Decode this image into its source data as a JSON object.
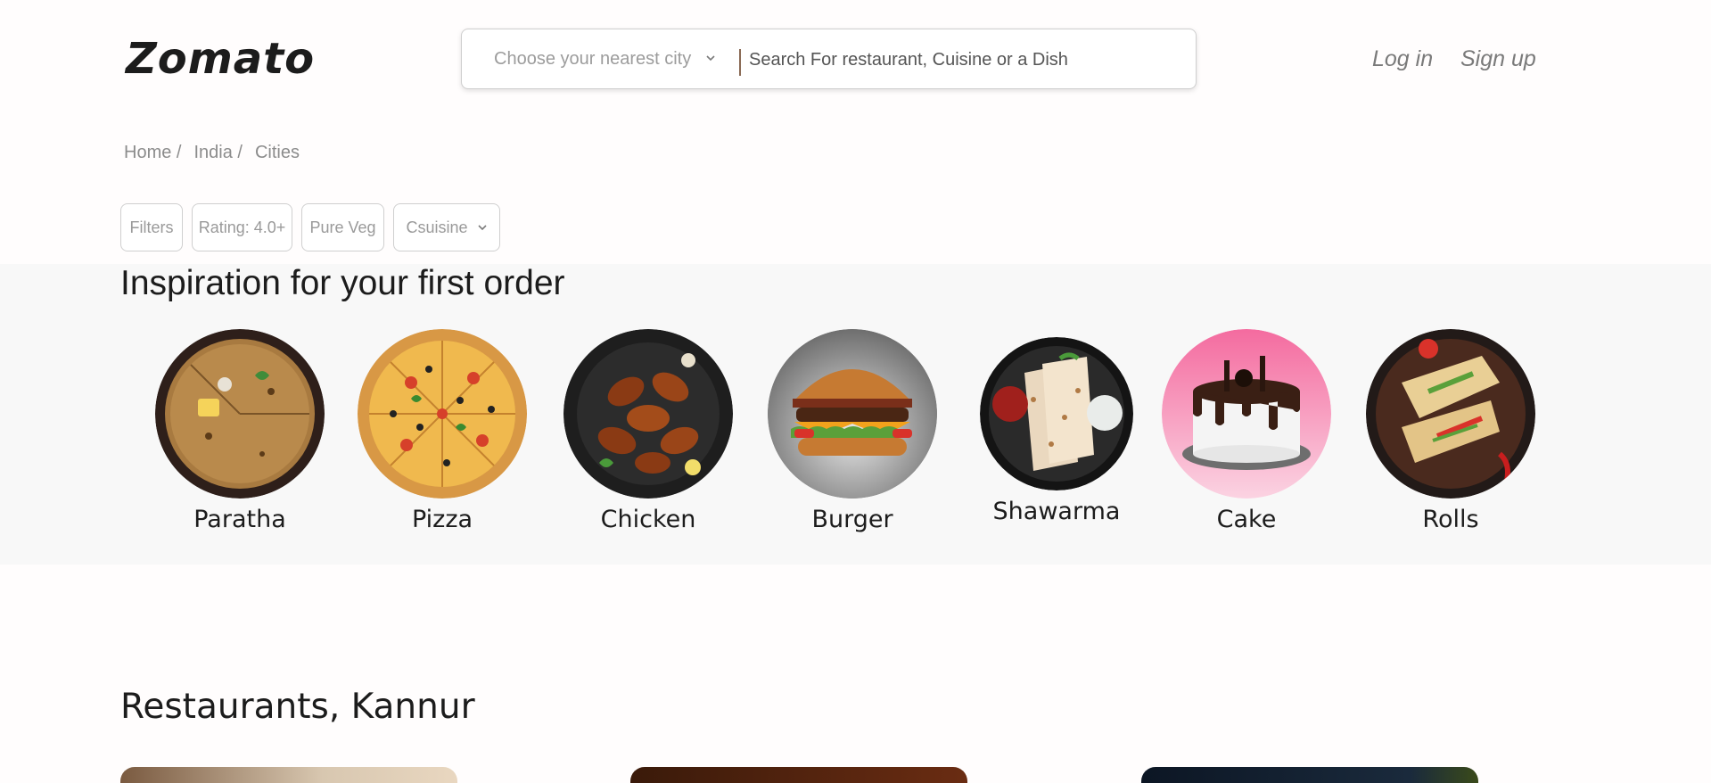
{
  "header": {
    "logo": "Zomato",
    "city_select": {
      "value": "Choose your nearest city",
      "icon": "chevron-down-icon"
    },
    "search": {
      "placeholder": "Search For restaurant, Cuisine or a Dish"
    },
    "login_label": "Log in",
    "signup_label": "Sign up"
  },
  "breadcrumb": [
    "Home /",
    "India /",
    "Cities"
  ],
  "filters": {
    "filters_label": "Filters",
    "rating_label": "Rating: 4.0+",
    "pure_veg_label": "Pure Veg",
    "cuisine_label": "Csuisine"
  },
  "inspiration": {
    "title": "Inspiration for your first order",
    "items": [
      {
        "label": "Paratha"
      },
      {
        "label": "Pizza"
      },
      {
        "label": "Chicken"
      },
      {
        "label": "Burger"
      },
      {
        "label": "Shawarma"
      },
      {
        "label": "Cake"
      },
      {
        "label": "Rolls"
      }
    ]
  },
  "restaurants": {
    "title": "Restaurants, Kannur"
  },
  "colors": {
    "page_bg": "#fffdfd",
    "band_bg": "#f8f8f8",
    "text": "#1c1c1c",
    "muted": "#9a9a9a"
  }
}
